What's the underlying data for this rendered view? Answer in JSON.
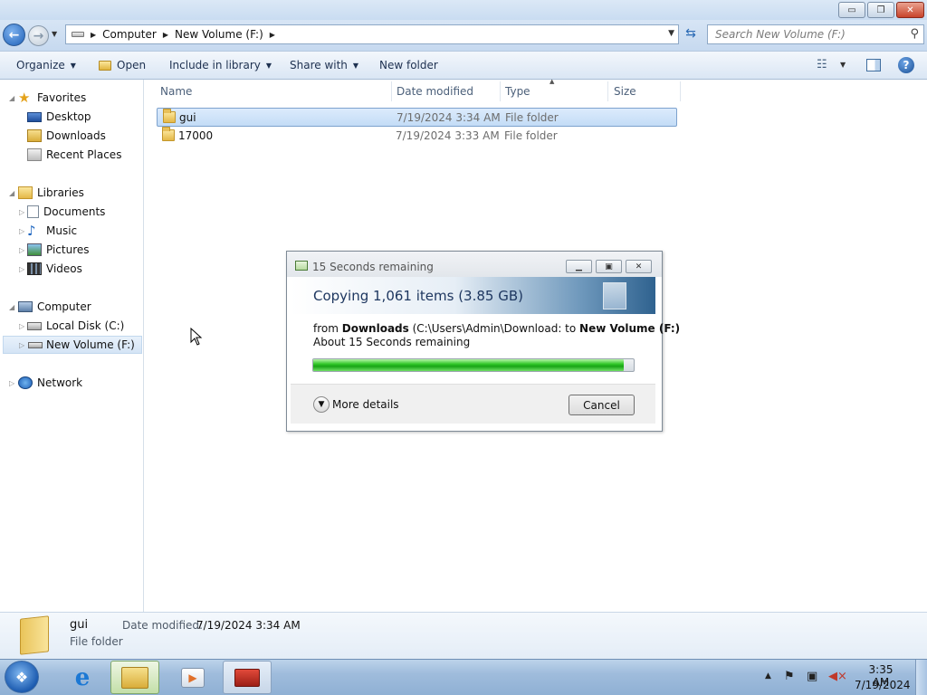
{
  "window": {
    "caption_buttons": {
      "minimize": "▭",
      "restore": "❐",
      "close": "✕"
    }
  },
  "address": {
    "crumbs": [
      "Computer",
      "New Volume (F:)"
    ],
    "search_placeholder": "Search New Volume (F:)"
  },
  "toolbar": {
    "organize": "Organize",
    "open": "Open",
    "include_in_library": "Include in library",
    "share_with": "Share with",
    "new_folder": "New folder"
  },
  "nav": {
    "favorites": {
      "label": "Favorites",
      "items": [
        "Desktop",
        "Downloads",
        "Recent Places"
      ]
    },
    "libraries": {
      "label": "Libraries",
      "items": [
        "Documents",
        "Music",
        "Pictures",
        "Videos"
      ]
    },
    "computer": {
      "label": "Computer",
      "items": [
        "Local Disk (C:)",
        "New Volume (F:)"
      ]
    },
    "network": {
      "label": "Network"
    }
  },
  "columns": [
    "Name",
    "Date modified",
    "Type",
    "Size"
  ],
  "files": [
    {
      "name": "gui",
      "date": "7/19/2024 3:34 AM",
      "type": "File folder",
      "selected": true
    },
    {
      "name": "17000",
      "date": "7/19/2024 3:33 AM",
      "type": "File folder",
      "selected": false
    }
  ],
  "details": {
    "name": "gui",
    "type": "File folder",
    "date_modified_label": "Date modified:",
    "date_modified_value": "7/19/2024 3:34 AM"
  },
  "dialog": {
    "title": "15 Seconds remaining",
    "header": "Copying 1,061 items (3.85 GB)",
    "from_prefix": "from ",
    "from_source": "Downloads",
    "from_path": " (C:\\Users\\Admin\\Download: to ",
    "from_dest": "New Volume (F:)",
    "remaining": "About 15 Seconds remaining",
    "progress": 0.97,
    "more_details": "More details",
    "cancel": "Cancel"
  },
  "taskbar": {
    "time": "3:35 AM",
    "date": "7/19/2024"
  },
  "colors": {
    "progress_green": "#32c829",
    "selection": "#c3dcf6",
    "taskbar": "#9fbcdc"
  }
}
